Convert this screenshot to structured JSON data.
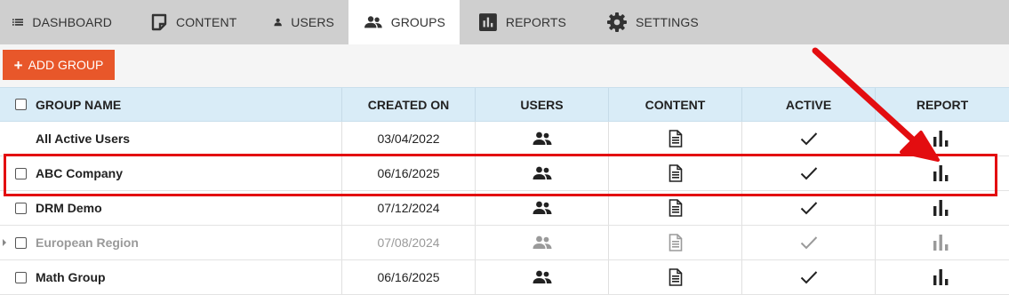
{
  "nav": {
    "tabs": [
      {
        "label": "DASHBOARD",
        "icon": "list-icon"
      },
      {
        "label": "CONTENT",
        "icon": "sticky-note-icon"
      },
      {
        "label": "USERS",
        "icon": "user-icon"
      },
      {
        "label": "GROUPS",
        "icon": "group-icon",
        "active": true
      },
      {
        "label": "REPORTS",
        "icon": "bar-chart-box-icon"
      },
      {
        "label": "SETTINGS",
        "icon": "gear-icon"
      }
    ]
  },
  "toolbar": {
    "add_label": "ADD GROUP",
    "add_icon": "plus-icon",
    "accent": "#e8572a"
  },
  "table": {
    "headers": {
      "name": "GROUP NAME",
      "created": "CREATED ON",
      "users": "USERS",
      "content": "CONTENT",
      "active": "ACTIVE",
      "report": "REPORT"
    },
    "rows": [
      {
        "name": "All Active Users",
        "created": "03/04/2022",
        "active": true,
        "has_checkbox": false
      },
      {
        "name": "ABC Company",
        "created": "06/16/2025",
        "active": true,
        "has_checkbox": true,
        "highlighted": true
      },
      {
        "name": "DRM Demo",
        "created": "07/12/2024",
        "active": true,
        "has_checkbox": true
      },
      {
        "name": "European Region",
        "created": "07/08/2024",
        "active": true,
        "has_checkbox": true,
        "dimmed": true,
        "expandable": true
      },
      {
        "name": "Math Group",
        "created": "06/16/2025",
        "active": true,
        "has_checkbox": true
      }
    ]
  },
  "annotation": {
    "color": "#e30d10"
  }
}
